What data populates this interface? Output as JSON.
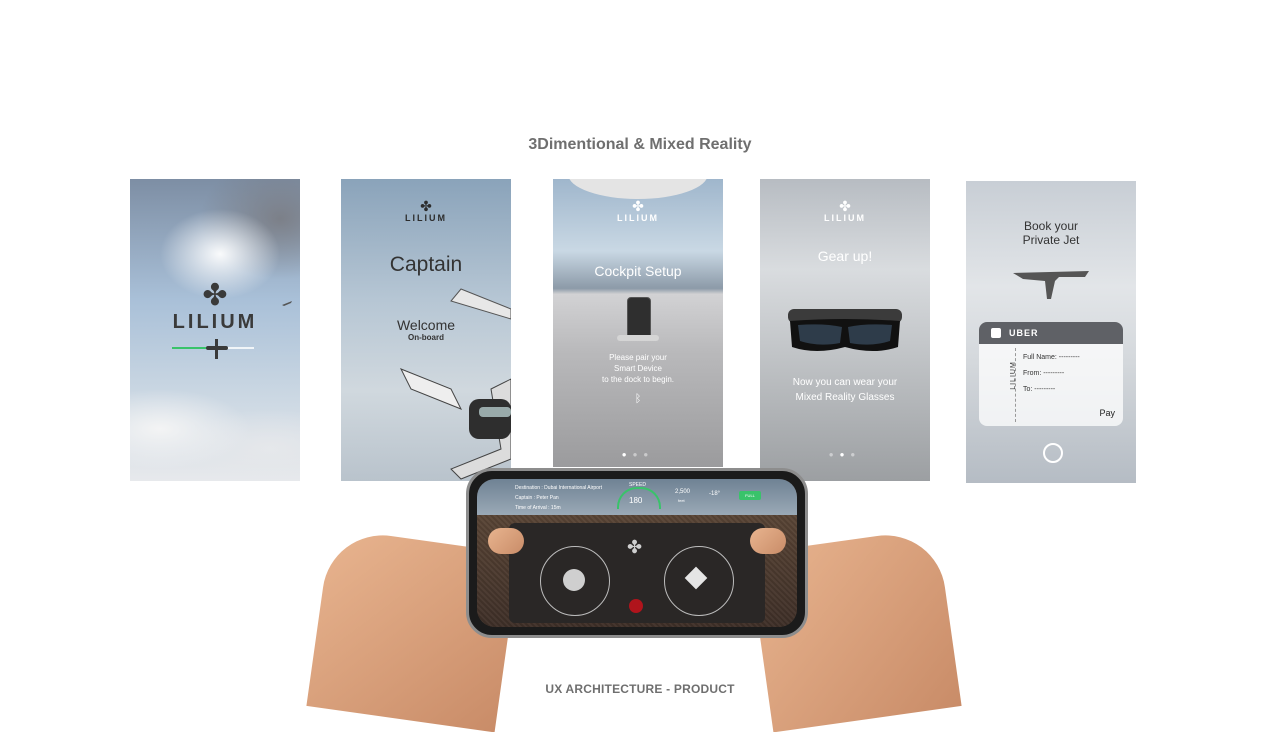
{
  "page": {
    "title": "3Dimentional & Mixed Reality",
    "footer": "UX ARCHITECTURE - PRODUCT"
  },
  "screens": {
    "splash": {
      "logo_text": "LILIUM"
    },
    "captain": {
      "logo_text": "LILIUM",
      "heading": "Captain",
      "welcome": "Welcome",
      "onboard": "On-board"
    },
    "cockpit": {
      "logo_text": "LILIUM",
      "heading": "Cockpit Setup",
      "instructions": [
        "Please pair your",
        "Smart Device",
        "to the dock to begin."
      ]
    },
    "gear": {
      "logo_text": "LILIUM",
      "heading": "Gear up!",
      "message": [
        "Now you can wear your",
        "Mixed Reality Glasses"
      ]
    },
    "booking": {
      "heading": [
        "Book your",
        "Private Jet"
      ],
      "ticket_brand": "UBER",
      "side_logo": "LILIUM",
      "fields": [
        "Full Name: ---------",
        "From: ---------",
        "To: ---------"
      ],
      "pay": "Pay"
    }
  },
  "phone": {
    "destination": "Destination : Dubai International Airport",
    "captain": "Captain : Peter Pan",
    "arrival": "Time of Arrival : 15m",
    "speed_label": "SPEED",
    "speed_value": "180",
    "altitude_value": "2,500",
    "altitude_unit": "feet",
    "pitch_value": "-18°",
    "battery_label": "FULL"
  },
  "colors": {
    "accent_green": "#39c36a",
    "record_red": "#b0141c"
  }
}
